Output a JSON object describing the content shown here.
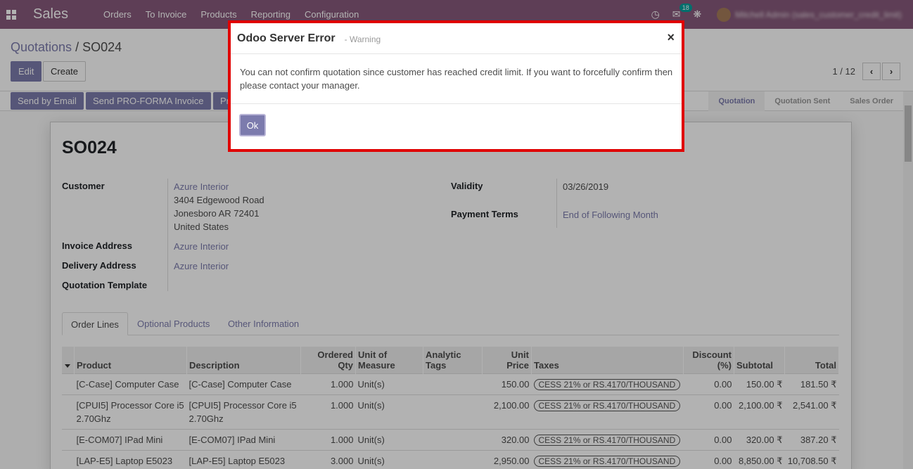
{
  "navbar": {
    "brand": "Sales",
    "menu": [
      "Orders",
      "To Invoice",
      "Products",
      "Reporting",
      "Configuration"
    ],
    "messages_count": "18",
    "user_name": "Mitchell Admin (sales_customer_credit_limit)"
  },
  "control": {
    "breadcrumb_parent": "Quotations",
    "breadcrumb_sep": "/",
    "breadcrumb_current": "SO024",
    "edit_label": "Edit",
    "create_label": "Create",
    "pager": "1 / 12"
  },
  "statusbar": {
    "buttons": [
      "Send by Email",
      "Send PRO-FORMA Invoice",
      "Pr"
    ],
    "stages": [
      "Quotation",
      "Quotation Sent",
      "Sales Order"
    ],
    "active_stage": "Quotation"
  },
  "form": {
    "title": "SO024",
    "customer_label": "Customer",
    "customer_name": "Azure Interior",
    "customer_addr1": "3404 Edgewood Road",
    "customer_addr2": "Jonesboro AR 72401",
    "customer_addr3": "United States",
    "invoice_address_label": "Invoice Address",
    "invoice_address": "Azure Interior",
    "delivery_address_label": "Delivery Address",
    "delivery_address": "Azure Interior",
    "quotation_template_label": "Quotation Template",
    "validity_label": "Validity",
    "validity": "03/26/2019",
    "payment_terms_label": "Payment Terms",
    "payment_terms": "End of Following Month"
  },
  "tabs": [
    "Order Lines",
    "Optional Products",
    "Other Information"
  ],
  "table": {
    "headers": {
      "product": "Product",
      "description": "Description",
      "ordered_qty_1": "Ordered",
      "ordered_qty_2": "Qty",
      "uom_1": "Unit of",
      "uom_2": "Measure",
      "analytic_1": "Analytic",
      "analytic_2": "Tags",
      "unit_price_1": "Unit",
      "unit_price_2": "Price",
      "taxes": "Taxes",
      "discount_1": "Discount",
      "discount_2": "(%)",
      "subtotal": "Subtotal",
      "total": "Total"
    },
    "rows": [
      {
        "product": "[C-Case] Computer Case",
        "description": "[C-Case] Computer Case",
        "qty": "1.000",
        "uom": "Unit(s)",
        "price": "150.00",
        "tax": "CESS 21% or RS.4170/THOUSAND",
        "discount": "0.00",
        "subtotal": "150.00 ₹",
        "total": "181.50 ₹"
      },
      {
        "product": "[CPUI5] Processor Core i5 2.70Ghz",
        "description": "[CPUI5] Processor Core i5 2.70Ghz",
        "qty": "1.000",
        "uom": "Unit(s)",
        "price": "2,100.00",
        "tax": "CESS 21% or RS.4170/THOUSAND",
        "discount": "0.00",
        "subtotal": "2,100.00 ₹",
        "total": "2,541.00 ₹"
      },
      {
        "product": "[E-COM07] IPad Mini",
        "description": "[E-COM07] IPad Mini",
        "qty": "1.000",
        "uom": "Unit(s)",
        "price": "320.00",
        "tax": "CESS 21% or RS.4170/THOUSAND",
        "discount": "0.00",
        "subtotal": "320.00 ₹",
        "total": "387.20 ₹"
      },
      {
        "product": "[LAP-E5] Laptop E5023",
        "description": "[LAP-E5] Laptop E5023",
        "qty": "3.000",
        "uom": "Unit(s)",
        "price": "2,950.00",
        "tax": "CESS 21% or RS.4170/THOUSAND",
        "discount": "0.00",
        "subtotal": "8,850.00 ₹",
        "total": "10,708.50 ₹"
      }
    ]
  },
  "modal": {
    "title": "Odoo Server Error",
    "subtitle": "- Warning",
    "message": "You can not confirm quotation since customer has reached credit limit. If you want to forcefully confirm then please contact your manager.",
    "ok_label": "Ok",
    "close_symbol": "×",
    "highlight_color": "#e00000"
  }
}
